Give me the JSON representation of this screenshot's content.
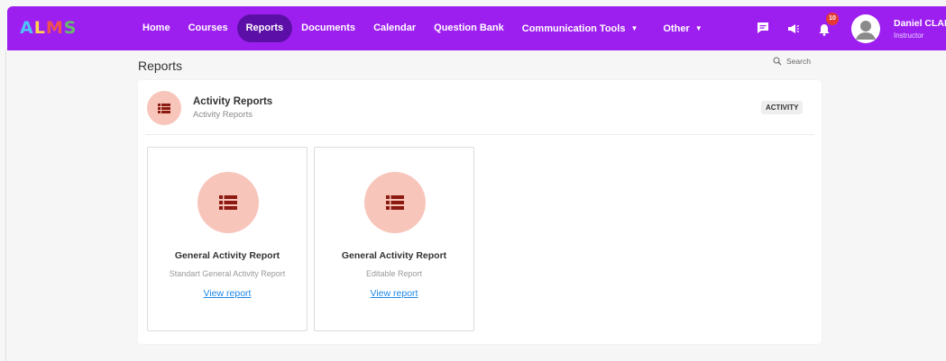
{
  "app": {
    "logo": [
      "A",
      "L",
      "M",
      "S"
    ]
  },
  "nav": {
    "items": [
      {
        "label": "Home"
      },
      {
        "label": "Courses"
      },
      {
        "label": "Reports",
        "active": true
      },
      {
        "label": "Documents"
      },
      {
        "label": "Calendar"
      },
      {
        "label": "Question Bank"
      },
      {
        "label": "Communication Tools",
        "dropdown": true
      },
      {
        "label": "Other",
        "dropdown": true
      }
    ]
  },
  "header_icons": {
    "messages_icon": "chat-icon",
    "announcements_icon": "megaphone-icon",
    "notifications_icon": "bell-icon",
    "notification_count": "10"
  },
  "user": {
    "name": "Daniel CLARK",
    "role": "Instructor"
  },
  "page": {
    "title": "Reports",
    "search_label": "Search"
  },
  "section": {
    "title": "Activity Reports",
    "subtitle": "Activity Reports",
    "tag": "ACTIVITY",
    "icon": "list-icon"
  },
  "reports": [
    {
      "title": "General Activity Report",
      "subtitle": "Standart General Activity Report",
      "link": "View report"
    },
    {
      "title": "General Activity Report",
      "subtitle": "Editable Report",
      "link": "View report"
    }
  ],
  "colors": {
    "topbar": "#9d1ff0",
    "active_nav": "#5c0fa6",
    "icon_bg": "#f8c5bb",
    "icon_fg": "#8b1a10",
    "link": "#1e88e5",
    "badge": "#e53935"
  }
}
